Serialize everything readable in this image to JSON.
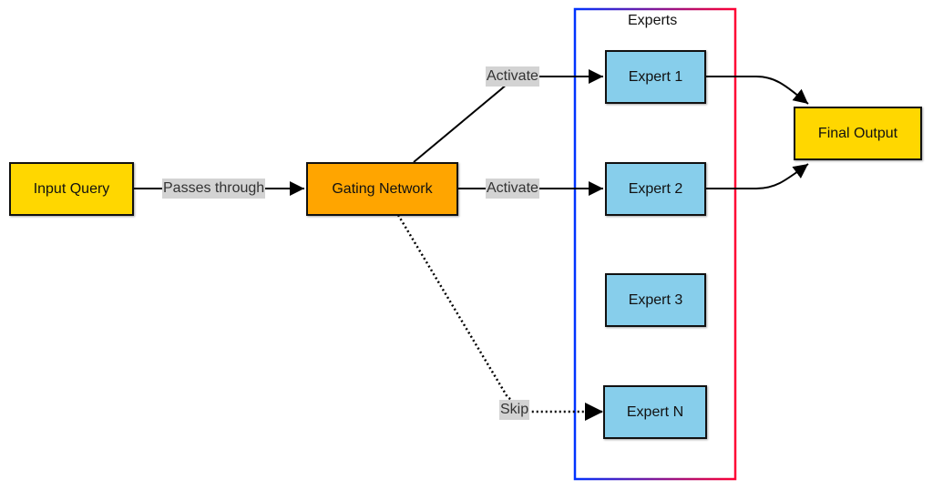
{
  "diagram": {
    "cluster": {
      "title": "Experts",
      "border_gradient": [
        "#0033ff",
        "#ff0033"
      ]
    },
    "nodes": {
      "input": {
        "label": "Input Query",
        "color": "#FFD700"
      },
      "gating": {
        "label": "Gating Network",
        "color": "#FFA500"
      },
      "expert1": {
        "label": "Expert 1",
        "color": "#87CEEB"
      },
      "expert2": {
        "label": "Expert 2",
        "color": "#87CEEB"
      },
      "expert3": {
        "label": "Expert 3",
        "color": "#87CEEB"
      },
      "expertN": {
        "label": "Expert N",
        "color": "#87CEEB"
      },
      "output": {
        "label": "Final Output",
        "color": "#FFD700"
      }
    },
    "edges": [
      {
        "from": "Input Query",
        "to": "Gating Network",
        "label": "Passes through",
        "style": "solid"
      },
      {
        "from": "Gating Network",
        "to": "Expert 1",
        "label": "Activate",
        "style": "solid"
      },
      {
        "from": "Gating Network",
        "to": "Expert 2",
        "label": "Activate",
        "style": "solid"
      },
      {
        "from": "Gating Network",
        "to": "Expert N",
        "label": "Skip",
        "style": "dotted"
      },
      {
        "from": "Expert 1",
        "to": "Final Output",
        "label": "",
        "style": "solid"
      },
      {
        "from": "Expert 2",
        "to": "Final Output",
        "label": "",
        "style": "solid"
      }
    ],
    "edge_labels": {
      "passes": "Passes through",
      "activate1": "Activate",
      "activate2": "Activate",
      "skip": "Skip"
    }
  }
}
